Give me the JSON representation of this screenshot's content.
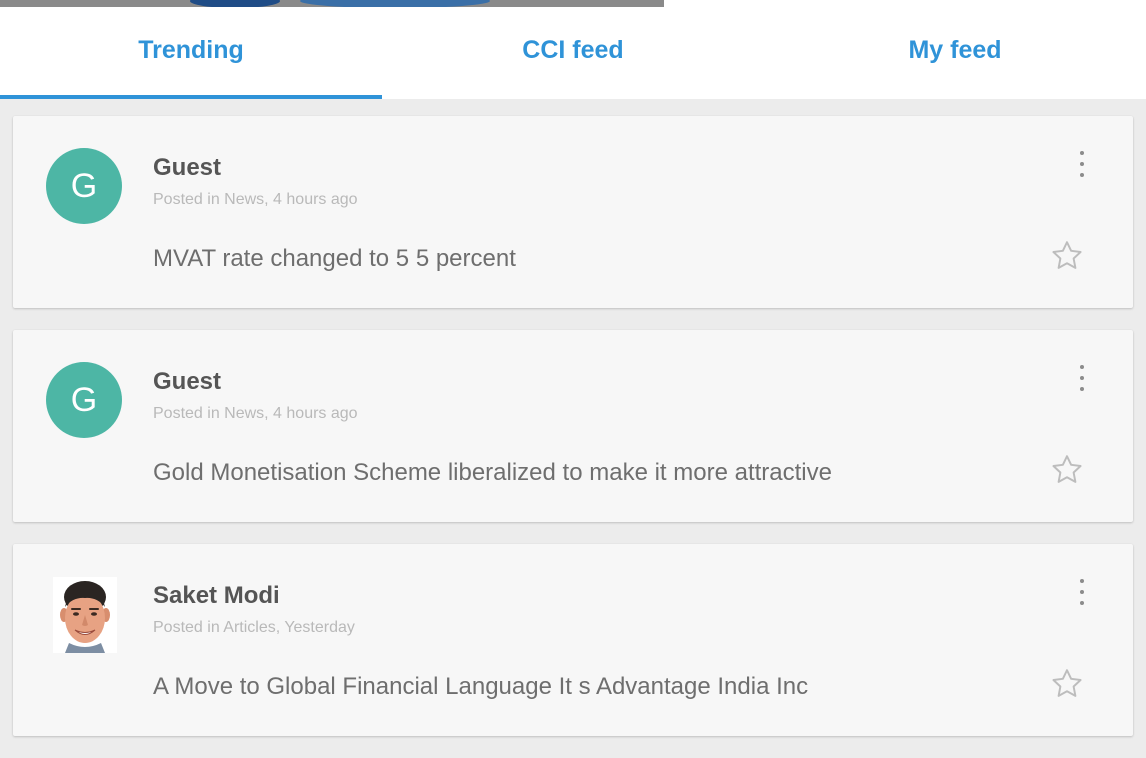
{
  "tabs": [
    {
      "label": "Trending",
      "active": true
    },
    {
      "label": "CCI feed",
      "active": false
    },
    {
      "label": "My feed",
      "active": false
    }
  ],
  "colors": {
    "accent": "#2f93d8",
    "avatar_bg": "#4db6a5",
    "card_bg": "#f7f7f7",
    "page_bg": "#ececec"
  },
  "posts": [
    {
      "author": "Guest",
      "avatar_letter": "G",
      "meta": "Posted in News, 4 hours ago",
      "text": "MVAT rate changed to 5 5 percent",
      "menu_icon": "more-vert-icon",
      "star_icon": "star-outline-icon"
    },
    {
      "author": "Guest",
      "avatar_letter": "G",
      "meta": "Posted in News, 4 hours ago",
      "text": "Gold Monetisation Scheme liberalized to make it more attractive",
      "menu_icon": "more-vert-icon",
      "star_icon": "star-outline-icon"
    },
    {
      "author": "Saket Modi",
      "avatar_letter": "",
      "meta": "Posted in Articles, Yesterday",
      "text": "A Move to Global Financial Language It s Advantage India Inc",
      "menu_icon": "more-vert-icon",
      "star_icon": "star-outline-icon"
    }
  ]
}
